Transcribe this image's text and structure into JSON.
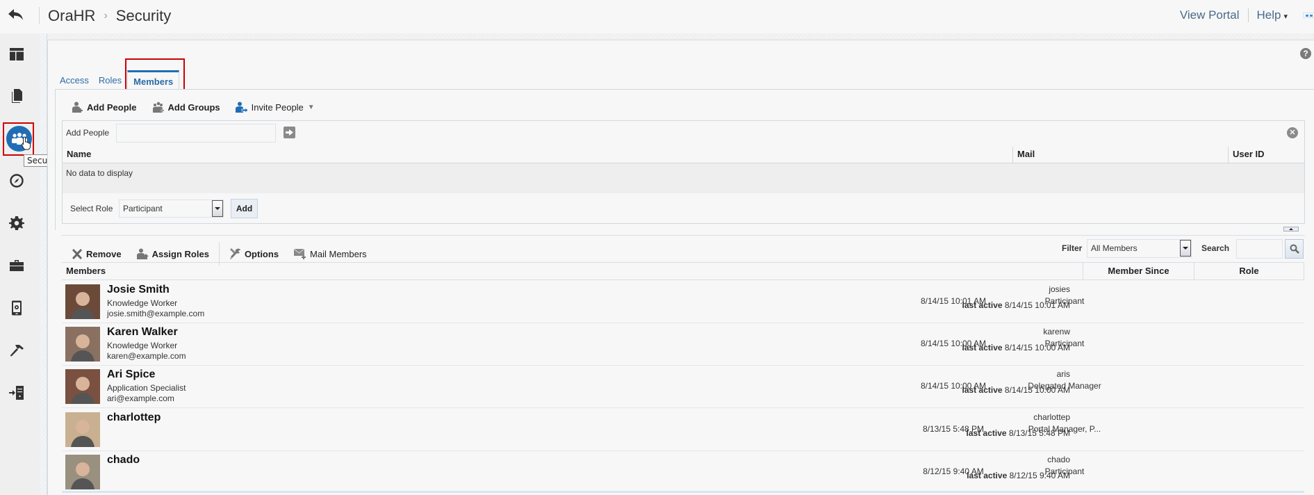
{
  "header": {
    "app_name": "OraHR",
    "breadcrumb_separator": "›",
    "page_title": "Security",
    "view_portal_label": "View Portal",
    "help_label": "Help",
    "help_caret": "▾"
  },
  "sidebar": {
    "items": [
      {
        "name": "pages",
        "icon": "layout-icon"
      },
      {
        "name": "assets",
        "icon": "documents-icon"
      },
      {
        "name": "security",
        "icon": "people-icon",
        "active": true
      },
      {
        "name": "navigation",
        "icon": "compass-icon"
      },
      {
        "name": "settings",
        "icon": "gear-icon"
      },
      {
        "name": "tools",
        "icon": "toolbox-icon"
      },
      {
        "name": "devices",
        "icon": "device-settings-icon"
      },
      {
        "name": "build",
        "icon": "hammer-icon"
      },
      {
        "name": "import",
        "icon": "server-import-icon"
      }
    ],
    "tooltip": "Security",
    "accent_color": "#1f6db5"
  },
  "tabs": [
    {
      "label": "Access",
      "active": false
    },
    {
      "label": "Roles",
      "active": false
    },
    {
      "label": "Members",
      "active": true
    }
  ],
  "help_icon_glyph": "?",
  "add_toolbar": {
    "add_people": "Add People",
    "add_groups": "Add Groups",
    "invite_people": "Invite People"
  },
  "add_panel": {
    "label": "Add People",
    "input_value": "",
    "columns": [
      "Name",
      "Mail",
      "User ID"
    ],
    "empty_text": "No data to display",
    "select_role_label": "Select Role",
    "select_role_value": "Participant",
    "add_button": "Add",
    "close_glyph": "✕"
  },
  "members_toolbar": {
    "remove": "Remove",
    "assign_roles": "Assign Roles",
    "options": "Options",
    "mail_members": "Mail Members",
    "filter_label": "Filter",
    "filter_value": "All Members",
    "search_label": "Search",
    "search_value": ""
  },
  "members_table": {
    "columns": [
      "Members",
      "Member Since",
      "Role"
    ],
    "last_active_label": "last active",
    "rows": [
      {
        "name": "Josie Smith",
        "title": "Knowledge Worker",
        "email": "josie.smith@example.com",
        "user_id": "josies",
        "last_active": "8/14/15 10:01 AM",
        "member_since": "8/14/15 10:01 AM",
        "role": "Participant",
        "avatar_color": "#6b4a3a"
      },
      {
        "name": "Karen Walker",
        "title": "Knowledge Worker",
        "email": "karen@example.com",
        "user_id": "karenw",
        "last_active": "8/14/15 10:00 AM",
        "member_since": "8/14/15 10:00 AM",
        "role": "Participant",
        "avatar_color": "#8a7060"
      },
      {
        "name": "Ari Spice",
        "title": "Application Specialist",
        "email": "ari@example.com",
        "user_id": "aris",
        "last_active": "8/14/15 10:00 AM",
        "member_since": "8/14/15 10:00 AM",
        "role": "Delegated Manager",
        "avatar_color": "#7a5040"
      },
      {
        "name": "charlottep",
        "title": "",
        "email": "",
        "user_id": "charlottep",
        "last_active": "8/13/15 5:48 PM",
        "member_since": "8/13/15 5:48 PM",
        "role": "Portal Manager, P...",
        "avatar_color": "#c8b090"
      },
      {
        "name": "chado",
        "title": "",
        "email": "",
        "user_id": "chado",
        "last_active": "8/12/15 9:40 AM",
        "member_since": "8/12/15 9:40 AM",
        "role": "Participant",
        "avatar_color": "#9a9080"
      }
    ]
  }
}
